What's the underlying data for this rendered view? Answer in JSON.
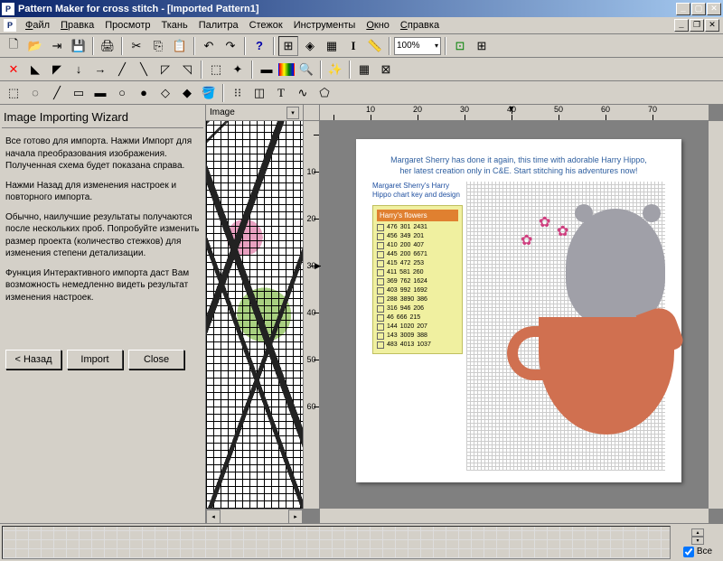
{
  "title": "Pattern Maker for cross stitch - [Imported Pattern1]",
  "menu": {
    "file": "Файл",
    "edit": "Правка",
    "view": "Просмотр",
    "fabric": "Ткань",
    "palette": "Палитра",
    "stitch": "Стежок",
    "tools": "Инструменты",
    "window": "Окно",
    "help": "Справка"
  },
  "toolbar": {
    "zoom_value": "100%"
  },
  "wizard": {
    "title": "Image Importing Wizard",
    "p1": "Все готово для импорта. Нажми Импорт для начала преобразования изображения. Полученная схема будет показана справа.",
    "p2": "Нажми Назад для изменения настроек и повторного импорта.",
    "p3": "Обычно, наилучшие результаты получаются после нескольких проб. Попробуйте изменить размер проекта (количество стежков) для изменения степени детализации.",
    "p4": "Функция Интерактивного импорта даст Вам возможность немедленно видеть результат изменения настроек.",
    "back": "< Назад",
    "import": "Import",
    "close": "Close"
  },
  "mid_tab": "Image",
  "ruler_h": [
    "10",
    "20",
    "30",
    "40",
    "50",
    "60",
    "70"
  ],
  "ruler_v": [
    "10",
    "20",
    "30",
    "40",
    "50",
    "60"
  ],
  "page": {
    "header1": "Margaret Sherry has done it again, this time with adorable Harry Hippo,",
    "header2": "her latest creation only in C&E. Start stitching his adventures now!",
    "key_title": "Harry's flowers",
    "key_rows": [
      {
        "a": "476",
        "b": "301",
        "c": "2431"
      },
      {
        "a": "456",
        "b": "349",
        "c": "201"
      },
      {
        "a": "410",
        "b": "200",
        "c": "407"
      },
      {
        "a": "445",
        "b": "200",
        "c": "6671"
      },
      {
        "a": "415",
        "b": "472",
        "c": "253"
      },
      {
        "a": "411",
        "b": "581",
        "c": "260"
      },
      {
        "a": "369",
        "b": "762",
        "c": "1624"
      },
      {
        "a": "403",
        "b": "992",
        "c": "1692"
      },
      {
        "a": "288",
        "b": "3890",
        "c": "386"
      },
      {
        "a": "316",
        "b": "946",
        "c": "206"
      },
      {
        "a": "46",
        "b": "666",
        "c": "215"
      },
      {
        "a": "144",
        "b": "1020",
        "c": "207"
      },
      {
        "a": "143",
        "b": "3009",
        "c": "388"
      },
      {
        "a": "483",
        "b": "4013",
        "c": "1037"
      }
    ]
  },
  "bottom": {
    "all": "Все"
  }
}
